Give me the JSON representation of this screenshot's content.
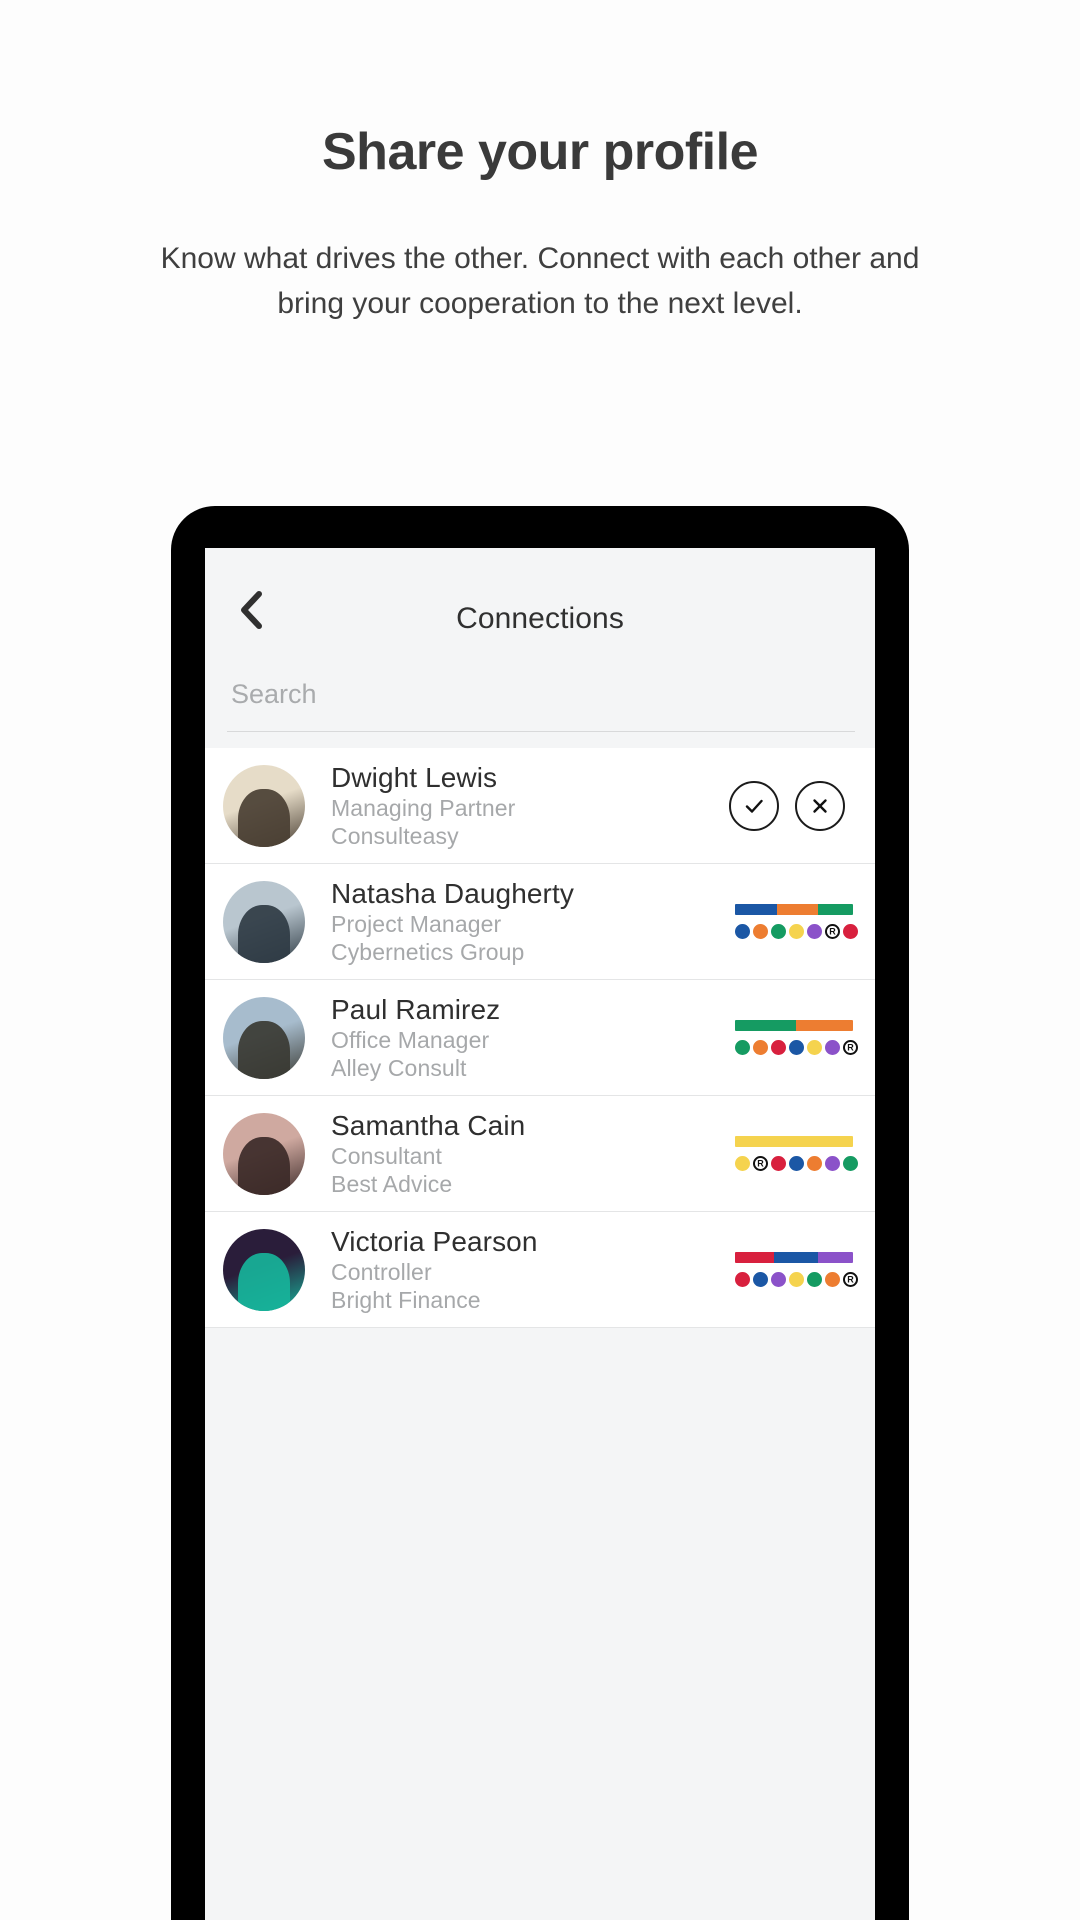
{
  "intro": {
    "headline": "Share your profile",
    "subhead": "Know what drives the other. Connect with each other and bring your cooperation to the next level."
  },
  "app": {
    "title": "Connections",
    "back_icon": "chevron-left-icon",
    "search": {
      "value": "",
      "placeholder": "Search"
    },
    "accept_icon": "check-icon",
    "decline_icon": "close-icon"
  },
  "colors": {
    "blue": "#1b57a5",
    "orange": "#ed7d31",
    "green": "#159b62",
    "yellow": "#f6d košик",
    "yellow_hex": "#f5d34e",
    "purple": "#8b52c9",
    "red": "#d8203e",
    "ring": "#ffffff",
    "screen_bg": "#f4f5f6",
    "row_bg": "#ffffff",
    "name_text": "#2f2f2f",
    "meta_text": "#a6a8aa"
  },
  "connections": [
    {
      "name": "Dwight Lewis",
      "role": "Managing Partner",
      "company": "Consulteasy",
      "state": "pending",
      "avatar": {
        "bg": "#e6dcc8",
        "subject": "#4a3f33"
      },
      "bar": [],
      "dots": []
    },
    {
      "name": "Natasha Daugherty",
      "role": "Project Manager",
      "company": "Cybernetics Group",
      "state": "connected",
      "avatar": {
        "bg": "#b9c6cf",
        "subject": "#2f3b44"
      },
      "bar": [
        {
          "color": "#1b57a5",
          "weight": 36
        },
        {
          "color": "#ed7d31",
          "weight": 34
        },
        {
          "color": "#159b62",
          "weight": 30
        }
      ],
      "dots": [
        {
          "color": "#1b57a5"
        },
        {
          "color": "#ed7d31"
        },
        {
          "color": "#159b62"
        },
        {
          "color": "#f5d34e"
        },
        {
          "color": "#8b52c9"
        },
        {
          "color": "#ffffff",
          "label": "R"
        },
        {
          "color": "#d8203e"
        }
      ]
    },
    {
      "name": "Paul Ramirez",
      "role": "Office Manager",
      "company": "Alley Consult",
      "state": "connected",
      "avatar": {
        "bg": "#a7bccd",
        "subject": "#3a3a33"
      },
      "bar": [
        {
          "color": "#159b62",
          "weight": 52
        },
        {
          "color": "#ed7d31",
          "weight": 48
        }
      ],
      "dots": [
        {
          "color": "#159b62"
        },
        {
          "color": "#ed7d31"
        },
        {
          "color": "#d8203e"
        },
        {
          "color": "#1b57a5"
        },
        {
          "color": "#f5d34e"
        },
        {
          "color": "#8b52c9"
        },
        {
          "color": "#ffffff",
          "label": "R"
        }
      ]
    },
    {
      "name": "Samantha Cain",
      "role": "Consultant",
      "company": "Best Advice",
      "state": "connected",
      "avatar": {
        "bg": "#cfa9a0",
        "subject": "#3c2a28"
      },
      "bar": [
        {
          "color": "#f5d34e",
          "weight": 100
        }
      ],
      "dots": [
        {
          "color": "#f5d34e"
        },
        {
          "color": "#ffffff",
          "label": "R"
        },
        {
          "color": "#d8203e"
        },
        {
          "color": "#1b57a5"
        },
        {
          "color": "#ed7d31"
        },
        {
          "color": "#8b52c9"
        },
        {
          "color": "#159b62"
        }
      ]
    },
    {
      "name": "Victoria Pearson",
      "role": "Controller",
      "company": "Bright Finance",
      "state": "connected",
      "avatar": {
        "bg": "#2a1d3a",
        "subject": "#17b39a"
      },
      "bar": [
        {
          "color": "#d8203e",
          "weight": 33
        },
        {
          "color": "#1b57a5",
          "weight": 37
        },
        {
          "color": "#8b52c9",
          "weight": 30
        }
      ],
      "dots": [
        {
          "color": "#d8203e"
        },
        {
          "color": "#1b57a5"
        },
        {
          "color": "#8b52c9"
        },
        {
          "color": "#f5d34e"
        },
        {
          "color": "#159b62"
        },
        {
          "color": "#ed7d31"
        },
        {
          "color": "#ffffff",
          "label": "R"
        }
      ]
    }
  ]
}
